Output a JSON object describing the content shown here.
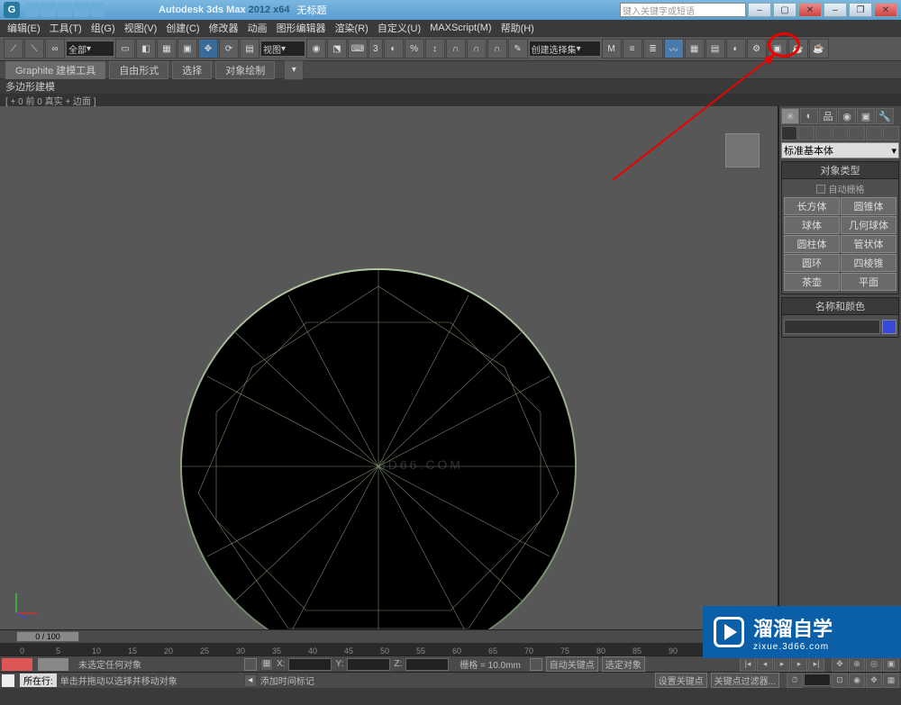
{
  "titlebar": {
    "app": "Autodesk 3ds Max",
    "version": "2012 x64",
    "filename": "无标题",
    "search_placeholder": "键入关键字或短语"
  },
  "menus": [
    "编辑(E)",
    "工具(T)",
    "组(G)",
    "视图(V)",
    "创建(C)",
    "修改器",
    "动画",
    "图形编辑器",
    "渲染(R)",
    "自定义(U)",
    "MAXScript(M)",
    "帮助(H)"
  ],
  "main_toolbar": {
    "filter_dropdown": "全部",
    "snap_label": "3",
    "selection_set": "创建选择集",
    "view_label": "视图"
  },
  "ribbon": {
    "title": "Graphite 建模工具",
    "tabs": [
      "自由形式",
      "选择",
      "对象绘制"
    ],
    "sub": "多边形建模"
  },
  "viewport_label": "[ + 0 前 0 真实 + 边面 ]",
  "command_panel": {
    "dropdown": "标准基本体",
    "rollout1": "对象类型",
    "autogrid": "自动栅格",
    "buttons": [
      [
        "长方体",
        "圆锥体"
      ],
      [
        "球体",
        "几何球体"
      ],
      [
        "圆柱体",
        "管状体"
      ],
      [
        "圆环",
        "四棱锥"
      ],
      [
        "茶壶",
        "平面"
      ]
    ],
    "rollout2": "名称和颜色"
  },
  "timeline": {
    "slider": "0 / 100",
    "ticks": [
      0,
      5,
      10,
      15,
      20,
      25,
      30,
      35,
      40,
      45,
      50,
      55,
      60,
      65,
      70,
      75,
      80,
      85,
      90
    ]
  },
  "status": {
    "btn_label": "所在行:",
    "msg1": "未选定任何对象",
    "msg2": "单击并拖动以选择并移动对象",
    "x": "X:",
    "y": "Y:",
    "z": "Z:",
    "grid": "栅格 = 10.0mm",
    "add_time": "添加时间标记",
    "autokey": "自动关键点",
    "selset": "选定对象",
    "setkey": "设置关键点",
    "keyfilter": "关键点过滤器..."
  },
  "watermark": {
    "big": "溜溜自学",
    "small": "zixue.3d66.com",
    "center": "3D66.COM"
  }
}
